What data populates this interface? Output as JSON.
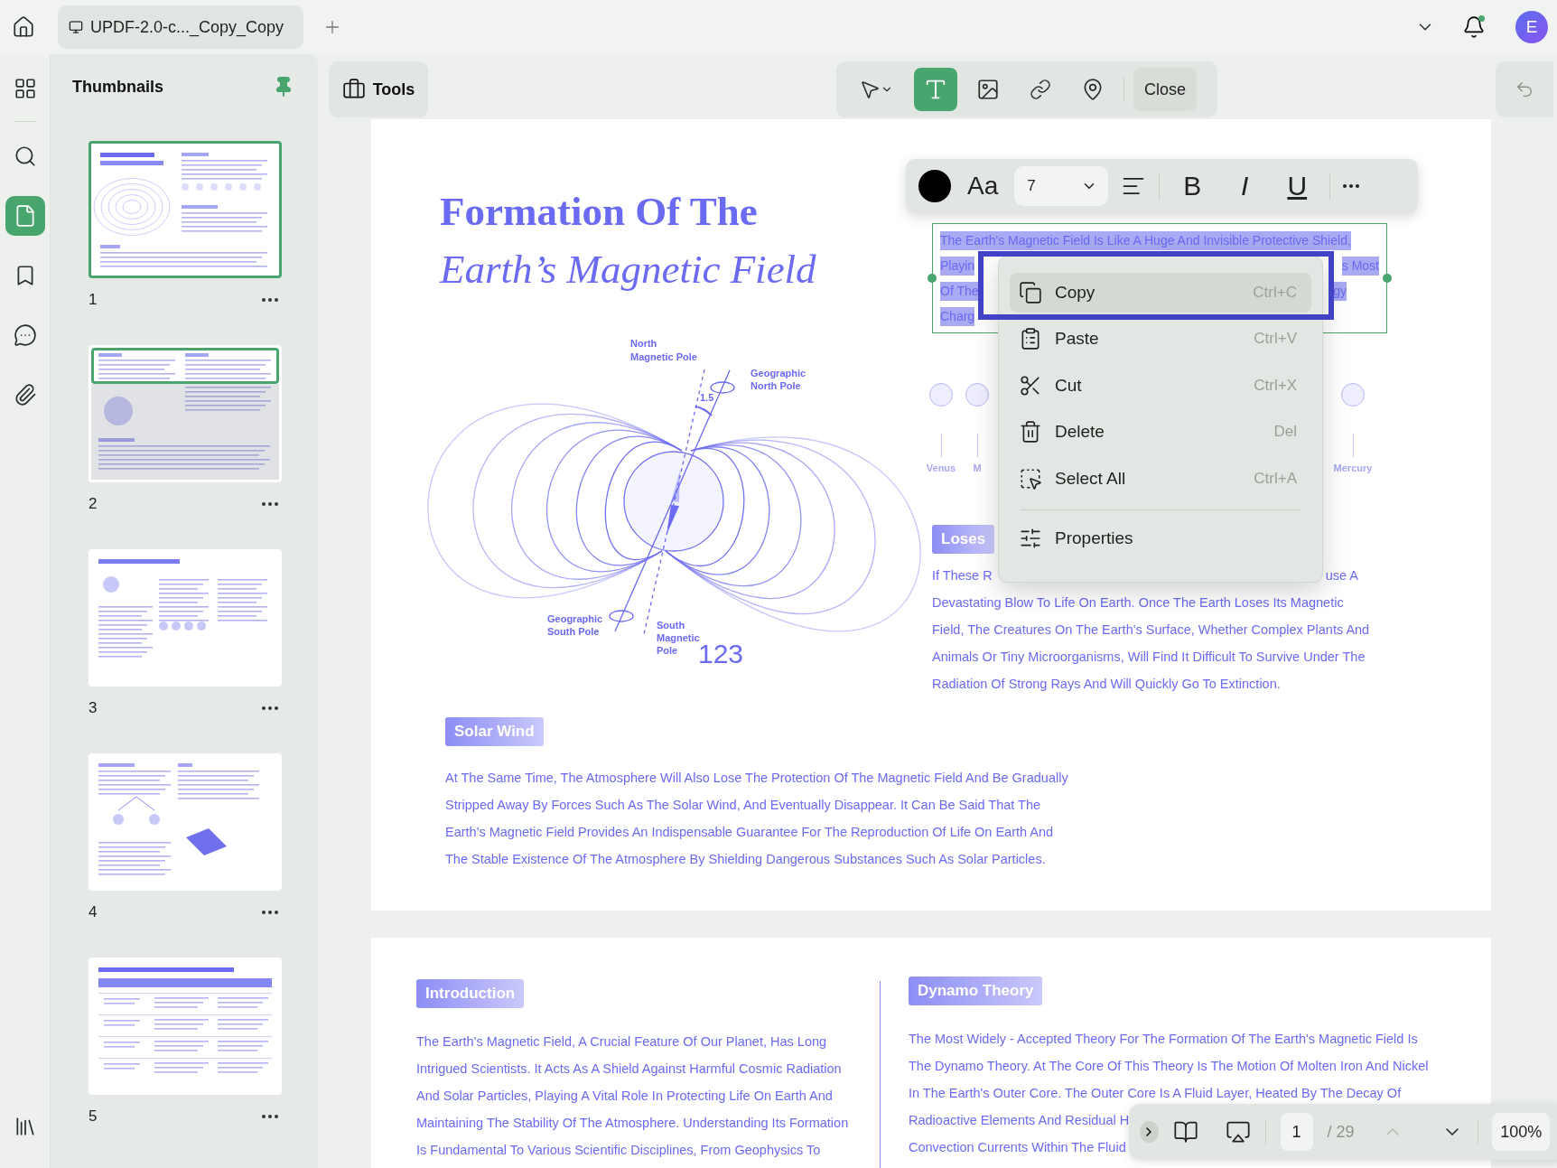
{
  "top_bar": {
    "tab_title": "UPDF-2.0-c..._Copy_Copy",
    "avatar": "E",
    "has_notification": true
  },
  "rail": [
    {
      "kind": "apps",
      "selected": false
    },
    {
      "kind": "search",
      "selected": false
    },
    {
      "kind": "pages",
      "selected": true
    },
    {
      "kind": "bookmark",
      "selected": false
    },
    {
      "kind": "comment",
      "selected": false
    },
    {
      "kind": "attachment",
      "selected": false
    }
  ],
  "thumbnails": {
    "title": "Thumbnails",
    "pages": [
      {
        "number": "1",
        "selected": true,
        "in_view": false
      },
      {
        "number": "2",
        "selected": false,
        "in_view": true
      },
      {
        "number": "3",
        "selected": false,
        "in_view": false
      },
      {
        "number": "4",
        "selected": false,
        "in_view": false
      },
      {
        "number": "5",
        "selected": false,
        "in_view": false
      }
    ]
  },
  "toolbar": {
    "tools_label": "Tools",
    "modes": [
      {
        "kind": "select",
        "selected": false
      },
      {
        "kind": "text",
        "selected": true
      },
      {
        "kind": "image",
        "selected": false
      },
      {
        "kind": "link",
        "selected": false
      },
      {
        "kind": "stamp",
        "selected": false
      }
    ],
    "close_label": "Close"
  },
  "format_bar": {
    "color": "#000000",
    "font_label": "Aa",
    "size": "7",
    "styles": [
      "B",
      "I",
      "U"
    ]
  },
  "context_menu": {
    "items": [
      {
        "kind": "copy",
        "label": "Copy",
        "shortcut": "Ctrl+C",
        "selected": true,
        "divider_before": false
      },
      {
        "kind": "paste",
        "label": "Paste",
        "shortcut": "Ctrl+V",
        "selected": false,
        "divider_before": false
      },
      {
        "kind": "cut",
        "label": "Cut",
        "shortcut": "Ctrl+X",
        "selected": false,
        "divider_before": false
      },
      {
        "kind": "delete",
        "label": "Delete",
        "shortcut": "Del",
        "selected": false,
        "divider_before": false
      },
      {
        "kind": "select_all",
        "label": "Select All",
        "shortcut": "Ctrl+A",
        "selected": false,
        "divider_before": false
      },
      {
        "kind": "properties",
        "label": "Properties",
        "selected": false,
        "divider_before": true
      }
    ]
  },
  "page_1": {
    "title": [
      "Formation Of The",
      "Earth’s Magnetic Field"
    ],
    "diagram": {
      "north_magnetic_pole": [
        "North",
        "Magnetic Pole"
      ],
      "geographic_north_pole": [
        "Geographic",
        "North Pole"
      ],
      "angle": "1.5",
      "geographic_south_pole": [
        "Geographic",
        "South Pole"
      ],
      "south_magnetic_pole": [
        "South",
        "Magnetic",
        "Pole"
      ],
      "number": "123"
    },
    "selected_text": [
      [
        "The Earth's Magnetic Field Is Like A Huge And Invisible Protective Shield,"
      ],
      [
        "Playin",
        "s Most"
      ],
      [
        "Of The",
        "gy"
      ],
      [
        "Charg"
      ]
    ],
    "planets": [
      {
        "name": "Venus"
      },
      {
        "name": "M"
      },
      {
        "name": "Mercury"
      }
    ],
    "loses_heading": "Loses",
    "loses_first_line": [
      "If These R",
      "use A"
    ],
    "loses_lines": [
      "Devastating Blow To Life On Earth. Once The Earth Loses Its Magnetic",
      "Field, The Creatures On The Earth's Surface, Whether Complex Plants And",
      "Animals Or Tiny Microorganisms, Will Find It Difficult To Survive Under The",
      "Radiation Of Strong Rays And Will Quickly Go To Extinction."
    ],
    "solar_heading": "Solar Wind",
    "solar_lines": [
      "At The Same Time, The Atmosphere Will Also Lose The Protection Of The Magnetic Field And Be Gradually",
      "Stripped Away By Forces Such As The Solar Wind, And Eventually Disappear. It Can Be Said That The",
      "Earth's Magnetic Field Provides An Indispensable Guarantee For The Reproduction Of Life On Earth And",
      "The Stable Existence Of The Atmosphere By Shielding Dangerous Substances Such As Solar Particles."
    ]
  },
  "page_2": {
    "intro_heading": "Introduction",
    "intro_lines": [
      "The Earth's Magnetic Field, A Crucial Feature Of Our Planet, Has Long",
      "Intrigued Scientists. It Acts As A Shield Against Harmful Cosmic Radiation",
      "And Solar Particles, Playing A Vital Role In Protecting Life On Earth And",
      "Maintaining The Stability Of The Atmosphere. Understanding Its Formation",
      "Is Fundamental To Various Scientific Disciplines, From Geophysics To"
    ],
    "dynamo_heading": "Dynamo Theory",
    "dynamo_lines": [
      "The Most Widely - Accepted Theory For The Formation Of The Earth's Magnetic Field Is",
      "The Dynamo Theory. At The Core Of This Theory Is The Motion Of Molten Iron And Nickel",
      "In The Earth's Outer Core. The Outer Core Is A Fluid Layer, Heated By The Decay Of"
    ],
    "dynamo_covered_lines": [
      "Radioactive Elements And Residual H",
      "Convection Currents Within The Fluid"
    ]
  },
  "page_bar": {
    "current_page": "1",
    "total": "/ 29",
    "zoom": "100%",
    "prev_disabled": true
  }
}
